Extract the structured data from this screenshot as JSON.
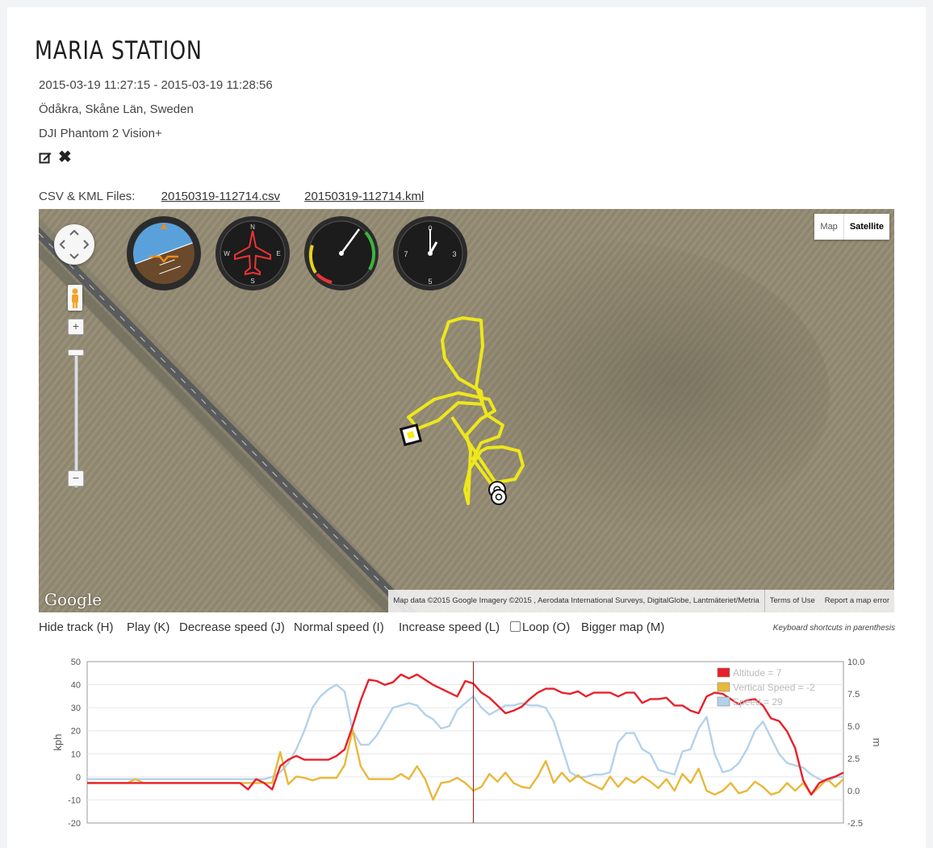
{
  "flight": {
    "title": "MARIA STATION",
    "time_range": "2015-03-19 11:27:15 - 2015-03-19 11:28:56",
    "location": "Ödåkra, Skåne Län, Sweden",
    "aircraft": "DJI Phantom 2 Vision+"
  },
  "actions": {
    "edit_icon": "edit-icon",
    "delete_icon": "close-icon"
  },
  "files": {
    "label": "CSV & KML Files:",
    "csv": "20150319-112714.csv",
    "kml": "20150319-112714.kml"
  },
  "map": {
    "type_buttons": [
      "Map",
      "Satellite"
    ],
    "active_type": "Satellite",
    "logo": "Google",
    "attribution": "Map data ©2015 Google Imagery ©2015 , Aerodata International Surveys, DigitalGlobe, Lantmäteriet/Metria",
    "terms": "Terms of Use",
    "report": "Report a map error",
    "track_color": "#f2ec16",
    "instruments": [
      "attitude-indicator",
      "heading-indicator",
      "airspeed-indicator",
      "altimeter"
    ]
  },
  "controls": {
    "hide_track": "Hide track (H)",
    "play": "Play (K)",
    "decrease_speed": "Decrease speed (J)",
    "normal_speed": "Normal speed (I)",
    "increase_speed": "Increase speed (L)",
    "loop": "Loop (O)",
    "bigger_map": "Bigger map (M)",
    "hint": "Keyboard shortcuts in parenthesis"
  },
  "chart_data": {
    "type": "line",
    "y_left": {
      "label": "kph",
      "ticks": [
        "50",
        "40",
        "30",
        "20",
        "10",
        "0",
        "-10",
        "-20"
      ],
      "range": [
        -20,
        50
      ]
    },
    "y_right": {
      "label": "m",
      "ticks": [
        "10.0",
        "7.5",
        "5.0",
        "2.5",
        "0.0",
        "-2.5"
      ],
      "range": [
        -2.5,
        10
      ]
    },
    "legend_position": "top-right",
    "cursor_index": 48,
    "series": [
      {
        "name": "Altitude = 7",
        "axis": "right",
        "color": "#e8202a",
        "values": [
          0.6,
          0.6,
          0.6,
          0.6,
          0.6,
          0.6,
          0.6,
          0.6,
          0.6,
          0.6,
          0.6,
          0.6,
          0.6,
          0.6,
          0.6,
          0.6,
          0.6,
          0.6,
          0.6,
          0.6,
          0.1,
          0.9,
          0.6,
          0.1,
          1.9,
          2.4,
          2.7,
          2.4,
          2.4,
          2.4,
          2.4,
          2.7,
          3.2,
          5.0,
          7.0,
          8.6,
          8.5,
          8.2,
          8.4,
          9.0,
          8.7,
          9.0,
          8.6,
          8.2,
          7.9,
          7.6,
          7.3,
          8.5,
          8.3,
          7.6,
          7.2,
          6.6,
          6.0,
          6.2,
          6.5,
          7.1,
          7.6,
          7.9,
          7.9,
          7.6,
          7.5,
          7.7,
          7.3,
          7.6,
          7.6,
          7.6,
          7.3,
          7.6,
          7.6,
          6.8,
          7.1,
          7.1,
          7.2,
          6.6,
          6.6,
          6.2,
          6.0,
          7.3,
          7.6,
          7.5,
          7.1,
          6.7,
          7.0,
          7.1,
          6.6,
          5.6,
          5.4,
          4.6,
          3.3,
          0.8,
          -0.3,
          0.6,
          0.9,
          1.1,
          1.4
        ],
        "values_shown_on_kph_scale": true
      },
      {
        "name": "Vertical Speed = -2",
        "axis": "right",
        "color": "#e8b83a",
        "values": [
          0.6,
          0.6,
          0.6,
          0.6,
          0.6,
          0.6,
          0.9,
          0.6,
          0.6,
          0.6,
          0.6,
          0.6,
          0.6,
          0.6,
          0.6,
          0.6,
          0.6,
          0.6,
          0.6,
          0.6,
          0.6,
          0.6,
          0.6,
          0.6,
          3.0,
          0.5,
          1.1,
          1.0,
          0.8,
          1.0,
          1.0,
          1.0,
          2.0,
          4.7,
          1.9,
          0.9,
          0.9,
          0.9,
          0.9,
          1.3,
          0.9,
          1.9,
          0.9,
          -0.7,
          0.6,
          0.7,
          1.0,
          0.6,
          0.0,
          0.3,
          1.3,
          0.7,
          1.4,
          0.6,
          0.3,
          0.2,
          1.1,
          2.3,
          0.6,
          1.4,
          0.7,
          1.2,
          0.7,
          0.4,
          0.1,
          1.1,
          0.3,
          1.0,
          0.6,
          1.1,
          0.7,
          0.2,
          0.9,
          0.0,
          1.3,
          0.6,
          1.7,
          0.0,
          -0.3,
          0.0,
          0.6,
          -0.2,
          0.0,
          0.7,
          0.3,
          -0.3,
          -0.1,
          0.6,
          0.0,
          0.6,
          -0.3,
          0.3,
          0.9,
          0.3,
          0.9
        ]
      },
      {
        "name": "Speed = 29",
        "axis": "left",
        "color": "#b3d2ea",
        "values": [
          -1,
          -1,
          -1,
          -1,
          -1,
          -1,
          -1,
          -1,
          -1,
          -1,
          -1,
          -1,
          -1,
          -1,
          -1,
          -1,
          -1,
          -1,
          -1,
          -1,
          -1,
          -1,
          -1,
          0,
          2,
          6,
          12,
          20,
          30,
          35,
          38,
          40,
          37,
          20,
          14,
          14,
          18,
          24,
          30,
          31,
          32,
          31,
          27,
          25,
          21,
          22,
          29,
          32,
          35,
          30,
          27,
          29,
          31,
          31,
          32,
          31,
          31,
          30,
          24,
          13,
          2,
          0,
          0,
          1,
          1,
          2,
          15,
          19,
          19,
          12,
          10,
          3,
          2,
          1,
          11,
          12,
          21,
          26,
          10,
          2,
          3,
          6,
          12,
          20,
          24,
          17,
          10,
          6,
          5,
          4,
          1,
          -1,
          -2,
          0,
          0
        ]
      }
    ]
  }
}
